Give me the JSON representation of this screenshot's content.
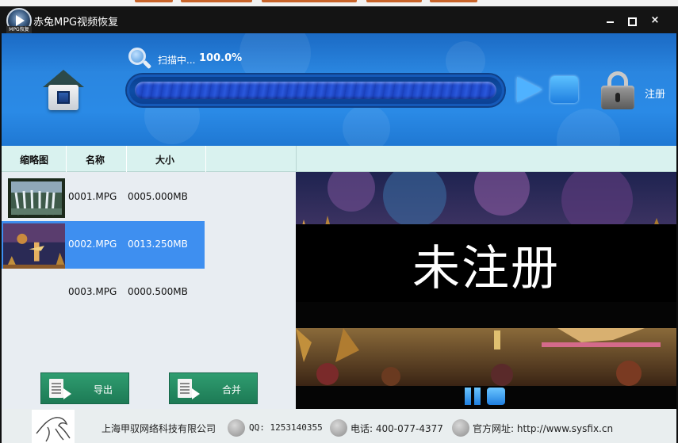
{
  "window": {
    "title": "赤兔MPG视频恢复",
    "logo_tag": "MPG恢复",
    "minimize_icon": "minimize-icon",
    "maximize_icon": "maximize-icon",
    "close_label": "×"
  },
  "header": {
    "scan_status": "扫描中...",
    "scan_percent": "100.0%",
    "progress": 1.0,
    "register_label": "注册"
  },
  "list": {
    "columns": [
      "缩略图",
      "名称",
      "大小"
    ],
    "rows": [
      {
        "name": "0001.MPG",
        "size": "0005.000MB",
        "selected": false,
        "thumbnail": "waterfall"
      },
      {
        "name": "0002.MPG",
        "size": "0013.250MB",
        "selected": true,
        "thumbnail": "stage-performance"
      },
      {
        "name": "0003.MPG",
        "size": "0000.500MB",
        "selected": false,
        "thumbnail": "none"
      }
    ],
    "export_label": "导出",
    "merge_label": "合并"
  },
  "preview": {
    "watermark": "未注册"
  },
  "footer": {
    "company": "上海甲驭网络科技有限公司",
    "qq": "QQ: 1253140355",
    "phone": "电话: 400-077-4377",
    "website": "官方网址: http://www.sysfix.cn"
  },
  "colors": {
    "header_blue": "#2a86e0",
    "selected_row": "#3e8ff0",
    "action_green": "#23865f",
    "list_header": "#d9f2ef"
  }
}
